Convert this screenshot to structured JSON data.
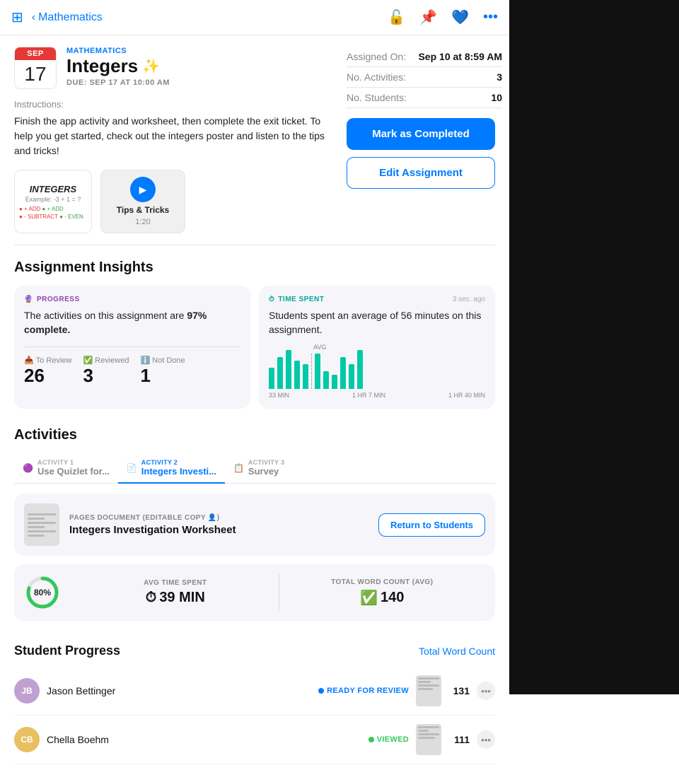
{
  "header": {
    "back_label": "Mathematics",
    "icons": [
      "unlock-icon",
      "pin-icon",
      "heart-icon",
      "more-icon"
    ]
  },
  "assignment": {
    "month": "SEP",
    "day": "17",
    "subject": "MATHEMATICS",
    "title": "Integers",
    "sparkle": "✨",
    "due_date": "DUE: SEP 17 AT 10:00 AM",
    "assigned_on_label": "Assigned On:",
    "assigned_on_value": "Sep 10 at 8:59 AM",
    "no_activities_label": "No. Activities:",
    "no_activities_value": "3",
    "no_students_label": "No. Students:",
    "no_students_value": "10"
  },
  "buttons": {
    "mark_completed": "Mark as Completed",
    "edit_assignment": "Edit Assignment"
  },
  "instructions": {
    "label": "Instructions:",
    "text": "Finish the app activity and worksheet, then complete the exit ticket. To help you get started, check out the integers poster and listen to the tips and tricks!"
  },
  "media": {
    "tile1_title": "INTEGERS",
    "tile1_subtitle": "Example: -3 + 1 = ?",
    "tile2_name": "Tips & Tricks",
    "tile2_duration": "1:20"
  },
  "insights": {
    "section_title": "Assignment Insights",
    "progress_tag": "PROGRESS",
    "progress_text": "The activities on this assignment are 97% complete.",
    "to_review_label": "To Review",
    "to_review_value": "26",
    "reviewed_label": "Reviewed",
    "reviewed_value": "3",
    "not_done_label": "Not Done",
    "not_done_value": "1",
    "time_spent_tag": "TIME SPENT",
    "time_ago": "3 sec. ago",
    "time_spent_text": "Students spent an average of 56 minutes on this assignment.",
    "chart_labels": [
      "33 MIN",
      "1 HR 7 MIN",
      "1 HR 40 MIN"
    ],
    "chart_y_labels": [
      "1",
      "0"
    ],
    "avg_label": "AVG"
  },
  "activities": {
    "section_title": "Activities",
    "tabs": [
      {
        "number": "ACTIVITY 1",
        "name": "Use Quizlet for...",
        "icon": "🟣"
      },
      {
        "number": "ACTIVITY 2",
        "name": "Integers Investi...",
        "icon": "📄"
      },
      {
        "number": "ACTIVITY 3",
        "name": "Survey",
        "icon": "📋"
      }
    ],
    "active_tab": 1,
    "doc_type": "PAGES DOCUMENT (EDITABLE COPY 👤)",
    "doc_name": "Integers Investigation Worksheet",
    "return_btn": "Return to Students",
    "progress_pct": "80%",
    "avg_time_label": "AVG TIME SPENT",
    "avg_time_value": "39 MIN",
    "word_count_label": "TOTAL WORD COUNT (AVG)",
    "word_count_value": "140"
  },
  "student_progress": {
    "section_title": "Student Progress",
    "total_word_count_link": "Total Word Count",
    "students": [
      {
        "initials": "JB",
        "name": "Jason Bettinger",
        "status": "READY FOR REVIEW",
        "status_type": "review",
        "word_count": "131"
      },
      {
        "initials": "CB",
        "name": "Chella Boehm",
        "status": "VIEWED",
        "status_type": "viewed",
        "word_count": "111"
      }
    ]
  }
}
